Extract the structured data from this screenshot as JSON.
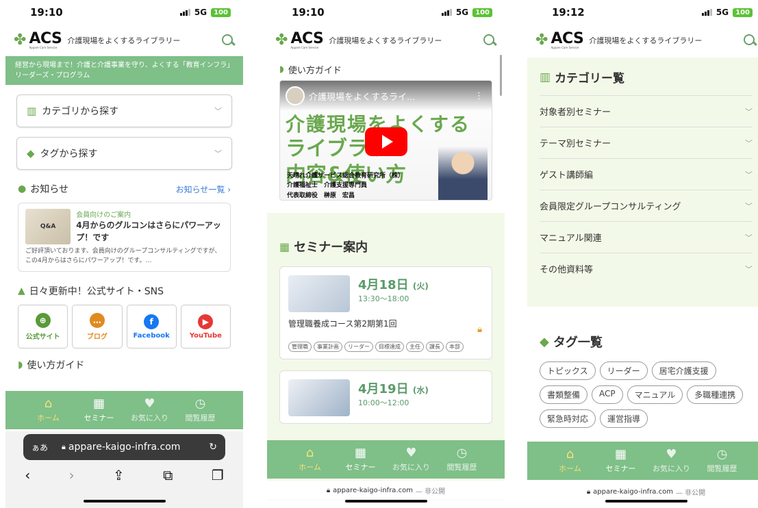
{
  "common": {
    "brand": "ACS",
    "brand_sub": "Appare Care Service",
    "tagline": "介護現場をよくするライブラリー",
    "url": "appare-kaigo-infra.com",
    "unpublished": "— 非公開",
    "tabs": [
      {
        "label": "ホーム",
        "icon": "home-icon"
      },
      {
        "label": "セミナー",
        "icon": "calendar-icon"
      },
      {
        "label": "お気に入り",
        "icon": "heart-icon"
      },
      {
        "label": "閲覧履歴",
        "icon": "clock-icon"
      }
    ],
    "accent": "#7fbf88"
  },
  "screen1": {
    "time": "19:10",
    "network": "5G",
    "battery": "100",
    "banner": "経営から現場まで！介護と介護事業を守り、よくする「教育インフラ」リーダーズ・プログラム",
    "acc_category": "カテゴリから探す",
    "acc_tag": "タグから探す",
    "news_heading": "お知らせ",
    "news_more": "お知らせ一覧",
    "news": {
      "img_label": "Q&A",
      "category": "会員向けのご案内",
      "title": "4月からのグルコンはさらにパワーアップ！です",
      "body": "ご好評頂いております、会員向けのグループコンサルティングですが、この4月からはさらにパワーアップ！です。…"
    },
    "sns_heading": "日々更新中！公式サイト・SNS",
    "sns": [
      {
        "label": "公式サイト",
        "color": "#5a9a3a"
      },
      {
        "label": "ブログ",
        "color": "#e08a20"
      },
      {
        "label": "Facebook",
        "color": "#1877f2"
      },
      {
        "label": "YouTube",
        "color": "#e53935"
      }
    ],
    "guide_heading": "使い方ガイド",
    "safari_aa": "ぁあ"
  },
  "screen2": {
    "time": "19:10",
    "network": "5G",
    "battery": "100",
    "guide_heading": "使い方ガイド",
    "video": {
      "title": "介護現場をよくするライ...",
      "big1": "介護現場をよくする",
      "big2a": "ライブラリー",
      "big2b": "内容&使い方",
      "info1": "天晴れ介護サービス総合教育研究所（株）",
      "info2": "介護福祉士　介護支援専門員",
      "info3": "代表取締役　榊原　宏昌"
    },
    "seminar_heading": "セミナー案内",
    "cards": [
      {
        "date": "4月18日",
        "dow": "(火)",
        "time": "13:30〜18:00",
        "name": "管理職養成コース第2期第1回",
        "tags": [
          "管理職",
          "事業計画",
          "リーダー",
          "目標達成",
          "主任",
          "課長",
          "本部"
        ]
      },
      {
        "date": "4月19日",
        "dow": "(水)",
        "time": "10:00〜12:00"
      }
    ]
  },
  "screen3": {
    "time": "19:12",
    "network": "5G",
    "battery": "100",
    "category_heading": "カテゴリー覧",
    "categories": [
      "対象者別セミナー",
      "テーマ別セミナー",
      "ゲスト講師編",
      "会員限定グループコンサルティング",
      "マニュアル関連",
      "その他資料等"
    ],
    "tag_heading": "タグ一覧",
    "tags": [
      "トピックス",
      "リーダー",
      "居宅介護支援",
      "書類整備",
      "ACP",
      "マニュアル",
      "多職種連携",
      "緊急時対応",
      "運営指導"
    ]
  }
}
